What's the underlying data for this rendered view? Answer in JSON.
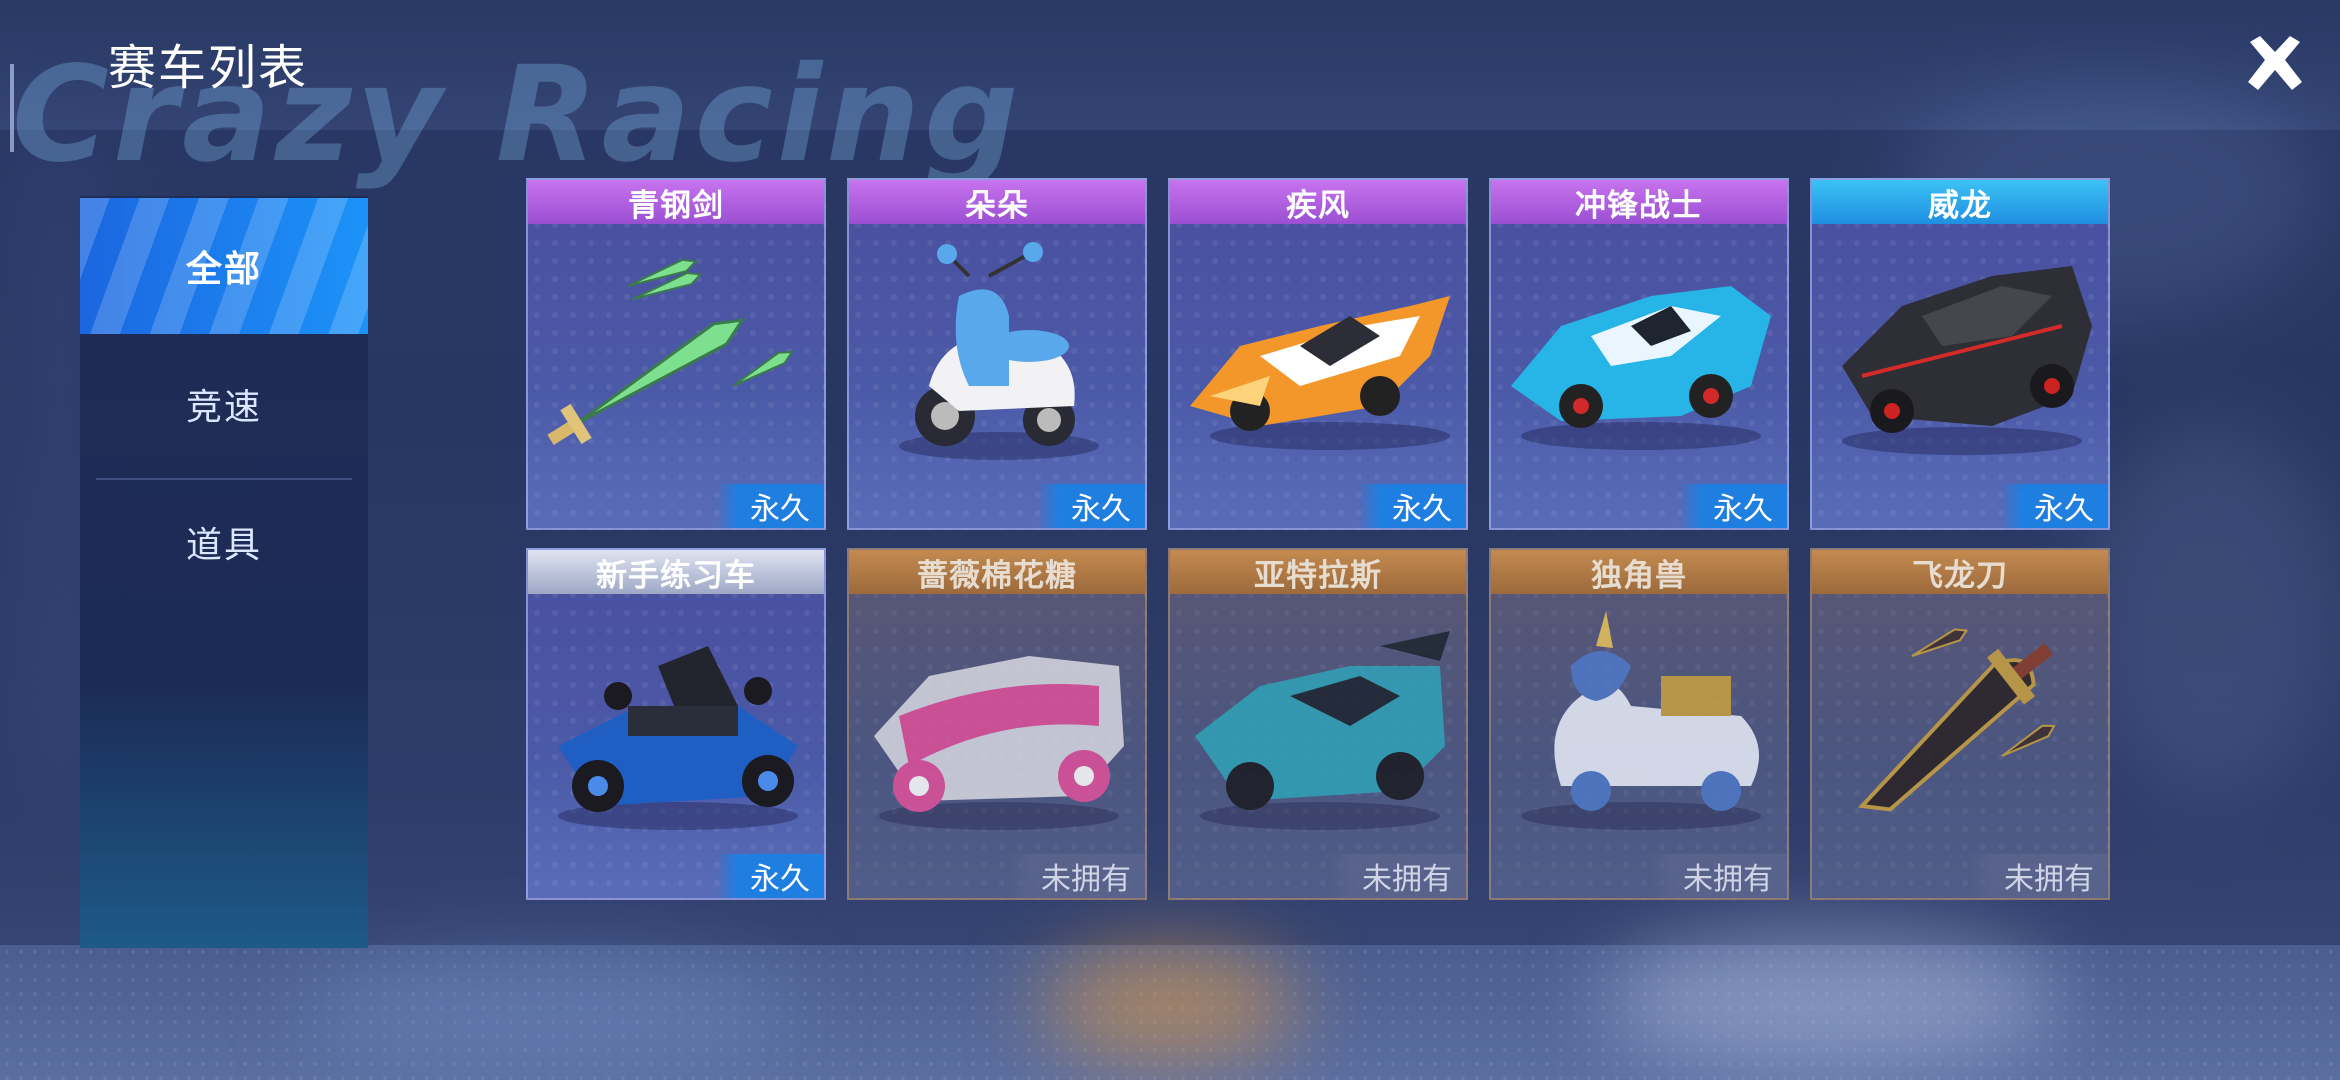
{
  "header": {
    "title": "赛车列表",
    "watermark": "Crazy Racing",
    "close_icon": "close-icon"
  },
  "sidebar": {
    "items": [
      {
        "label": "全部",
        "active": true
      },
      {
        "label": "竞速",
        "active": false
      },
      {
        "label": "道具",
        "active": false
      }
    ]
  },
  "cars": [
    {
      "name": "青钢剑",
      "status": "永久",
      "owned": true,
      "icon": "sword-icon"
    },
    {
      "name": "朵朵",
      "status": "永久",
      "owned": true,
      "icon": "scooter-icon"
    },
    {
      "name": "疾风",
      "status": "永久",
      "owned": true,
      "icon": "race-car-icon"
    },
    {
      "name": "冲锋战士",
      "status": "永久",
      "owned": true,
      "icon": "race-car-icon"
    },
    {
      "name": "威龙",
      "status": "永久",
      "owned": true,
      "icon": "race-car-icon"
    },
    {
      "name": "新手练习车",
      "status": "永久",
      "owned": true,
      "icon": "kart-icon"
    },
    {
      "name": "蔷薇棉花糖",
      "status": "未拥有",
      "owned": false,
      "icon": "race-car-icon"
    },
    {
      "name": "亚特拉斯",
      "status": "未拥有",
      "owned": false,
      "icon": "race-car-icon"
    },
    {
      "name": "独角兽",
      "status": "未拥有",
      "owned": false,
      "icon": "unicorn-car-icon"
    },
    {
      "name": "飞龙刀",
      "status": "未拥有",
      "owned": false,
      "icon": "blade-icon"
    }
  ],
  "colors": {
    "accent": "#1c93f8",
    "rare_purple": "#b364e4",
    "rare_blue": "#2ea9ee",
    "owned_badge": "#1f7fe0",
    "locked_header": "#b07c48"
  }
}
